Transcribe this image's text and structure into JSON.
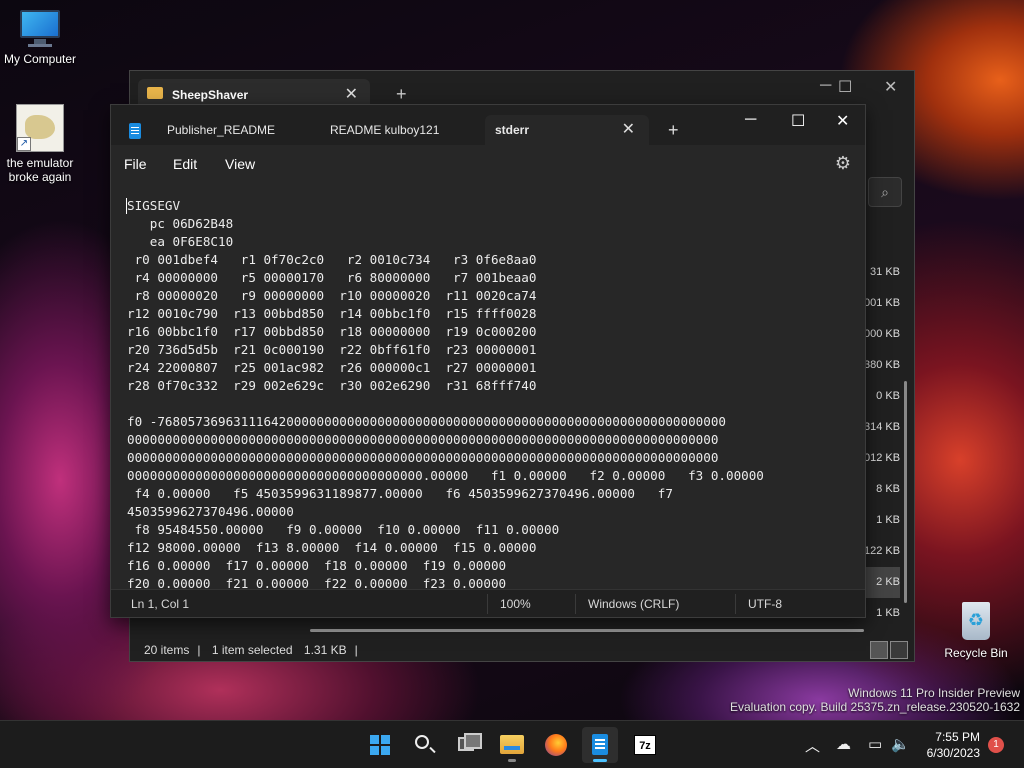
{
  "desktop": {
    "icons": [
      {
        "label": "My Computer"
      },
      {
        "label": "the emulator broke again"
      },
      {
        "label": "Recycle Bin"
      }
    ],
    "watermark_line1": "Windows 11 Pro Insider Preview",
    "watermark_line2": "Evaluation copy. Build 25375.zn_release.230520-1632"
  },
  "explorer": {
    "tab_title": "SheepShaver",
    "file_sizes": [
      "31 KB",
      "001 KB",
      "000 KB",
      "380 KB",
      "0 KB",
      "314 KB",
      "012 KB",
      "8 KB",
      "1 KB",
      "122 KB",
      "2 KB",
      "1 KB"
    ],
    "selected_index": 10,
    "status_items": "20 items",
    "status_selected": "1 item selected",
    "status_size": "1.31 KB"
  },
  "notepad": {
    "tabs": [
      {
        "label": "Publisher_README"
      },
      {
        "label": "README kulboy121"
      },
      {
        "label": "stderr"
      }
    ],
    "active_tab": 2,
    "menu": {
      "file": "File",
      "edit": "Edit",
      "view": "View"
    },
    "content": "SIGSEGV\n   pc 06D62B48\n   ea 0F6E8C10\n r0 001dbef4   r1 0f70c2c0   r2 0010c734   r3 0f6e8aa0\n r4 00000000   r5 00000170   r6 80000000   r7 001beaa0\n r8 00000020   r9 00000000  r10 00000020  r11 0020ca74\nr12 0010c790  r13 00bbd850  r14 00bbc1f0  r15 ffff0028\nr16 00bbc1f0  r17 00bbd850  r18 00000000  r19 0c000200\nr20 736d5d5b  r21 0c000190  r22 0bff61f0  r23 00000001\nr24 22000807  r25 001ac982  r26 000000c1  r27 00000001\nr28 0f70c332  r29 002e629c  r30 002e6290  r31 68fff740\n\nf0 -768057369631116420000000000000000000000000000000000000000000000000000000000\n000000000000000000000000000000000000000000000000000000000000000000000000000000\n000000000000000000000000000000000000000000000000000000000000000000000000000000\n000000000000000000000000000000000000000.00000   f1 0.00000   f2 0.00000   f3 0.00000\n f4 0.00000   f5 4503599631189877.00000   f6 4503599627370496.00000   f7\n4503599627370496.00000\n f8 95484550.00000   f9 0.00000  f10 0.00000  f11 0.00000\nf12 98000.00000  f13 8.00000  f14 0.00000  f15 0.00000\nf16 0.00000  f17 0.00000  f18 0.00000  f19 0.00000\nf20 0.00000  f21 0.00000  f22 0.00000  f23 0.00000",
    "status": {
      "position": "Ln 1, Col 1",
      "zoom": "100%",
      "line_ending": "Windows (CRLF)",
      "encoding": "UTF-8"
    }
  },
  "taskbar": {
    "time": "7:55 PM",
    "date": "6/30/2023",
    "notification_count": "1",
    "seven_zip_label": "7z"
  }
}
